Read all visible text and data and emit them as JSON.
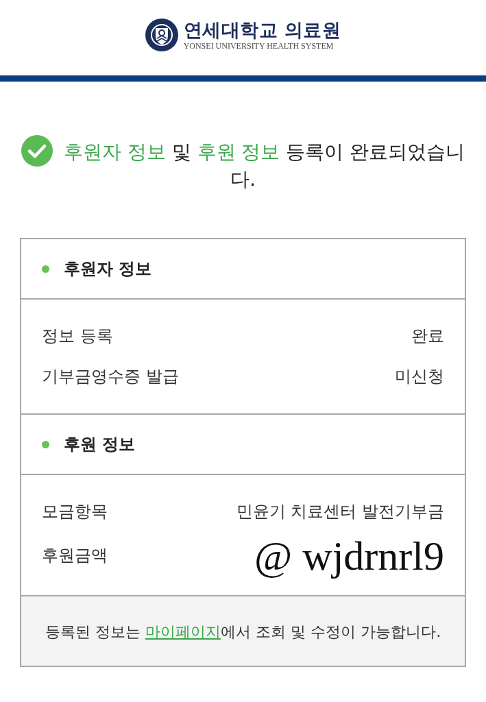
{
  "header": {
    "logo": {
      "name": "연세대학교 의료원",
      "subtitle": "YONSEI UNIVERSITY HEALTH SYSTEM"
    }
  },
  "status": {
    "kind": "success",
    "message": [
      {
        "text": "후원자 정보",
        "highlight": true
      },
      {
        "text": " 및 ",
        "highlight": false
      },
      {
        "text": "후원 정보",
        "highlight": true
      },
      {
        "text": " 등록이 완료되었습니다.",
        "highlight": false
      }
    ]
  },
  "sections": [
    {
      "title": "후원자 정보",
      "rows": [
        {
          "label": "정보 등록",
          "value": "완료",
          "kind": "text"
        },
        {
          "label": "기부금영수증 발급",
          "value": "미신청",
          "kind": "text"
        }
      ]
    },
    {
      "title": "후원 정보",
      "rows": [
        {
          "label": "모금항목",
          "value": "민윤기 치료센터 발전기부금",
          "kind": "text"
        },
        {
          "label": "후원금액",
          "value": "@ wjdrnrl9",
          "kind": "overlay"
        }
      ]
    }
  ],
  "footer": {
    "note": {
      "before": "등록된 정보는 ",
      "link": "마이페이지",
      "after": "에서 조회 및 수정이 가능합니다."
    }
  }
}
